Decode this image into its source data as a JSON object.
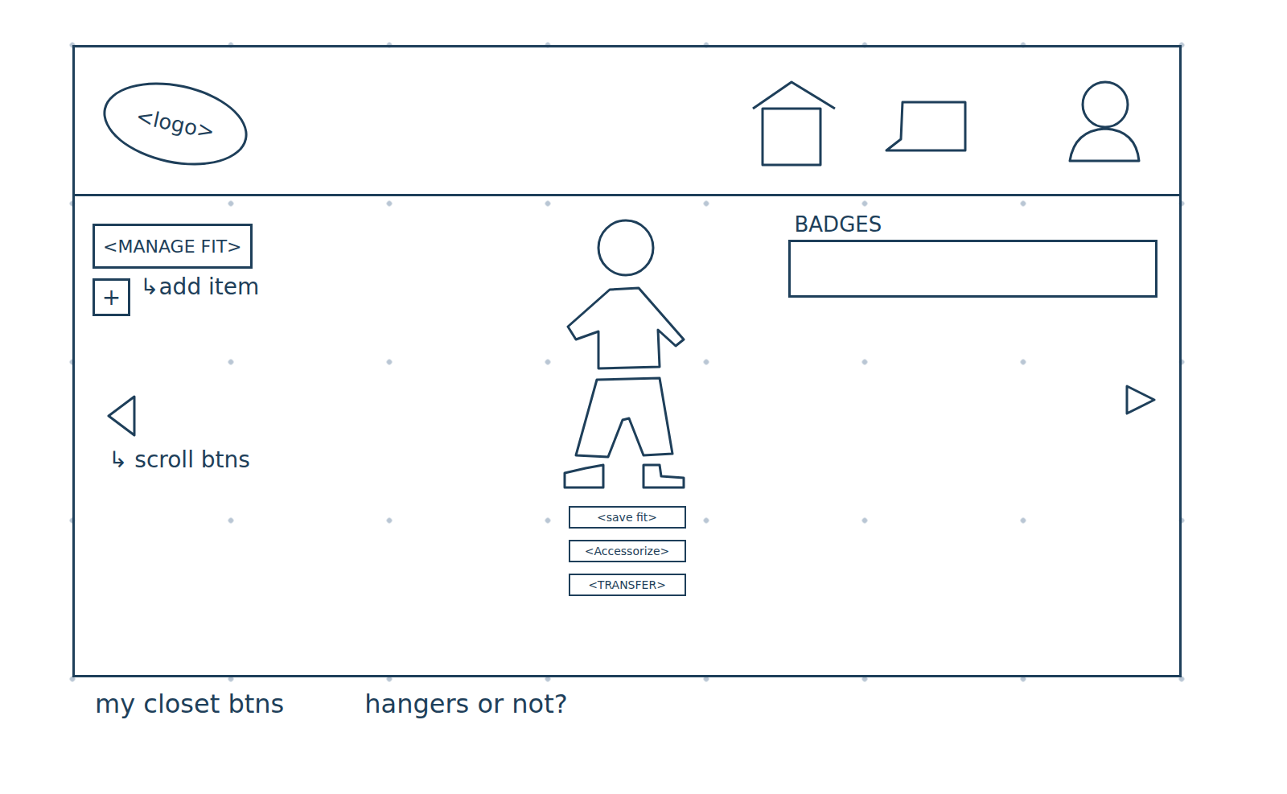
{
  "logo": "<logo>",
  "manage_button": "<MANAGE FIT>",
  "add_item": {
    "icon": "+",
    "label": "↳add item"
  },
  "scroll_note": "↳ scroll btns",
  "badges": {
    "title": "BADGES"
  },
  "actions": [
    "<save fit>",
    "<Accessorize>",
    "<TRANSFER>"
  ],
  "notes": [
    "my closet btns",
    "hangers or not?"
  ]
}
